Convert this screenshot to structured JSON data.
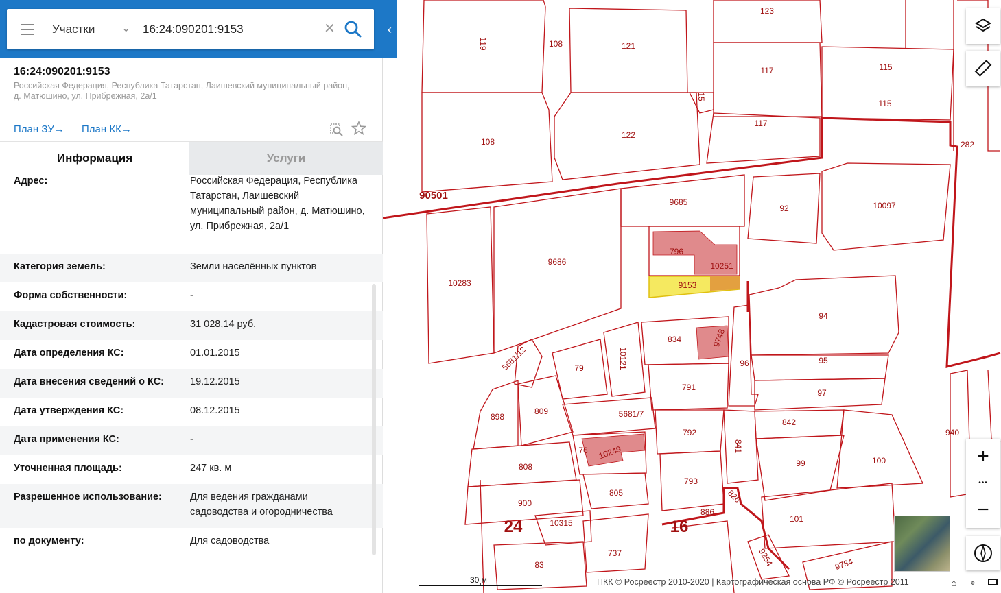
{
  "search": {
    "mode": "Участки",
    "query": "16:24:090201:9153"
  },
  "parcel": {
    "cadnum": "16:24:090201:9153",
    "address_short": "Российская Федерация, Республика Татарстан, Лаишевский муниципальный район, д. Матюшино, ул. Прибрежная, 2а/1",
    "plan_zu": "План ЗУ",
    "plan_kk": "План КК"
  },
  "tabs": {
    "info": "Информация",
    "services": "Услуги"
  },
  "rows": [
    {
      "label": "Адрес:",
      "value": "Российская Федерация, Республика Татарстан, Лаишевский муниципальный район, д. Матюшино, ул. Прибрежная, 2а/1"
    },
    {
      "label": "Категория земель:",
      "value": "Земли населённых пунктов"
    },
    {
      "label": "Форма собственности:",
      "value": "-"
    },
    {
      "label": "Кадастровая стоимость:",
      "value": "31 028,14 руб."
    },
    {
      "label": "Дата определения КС:",
      "value": "01.01.2015"
    },
    {
      "label": "Дата внесения сведений о КС:",
      "value": "19.12.2015"
    },
    {
      "label": "Дата утверждения КС:",
      "value": "08.12.2015"
    },
    {
      "label": "Дата применения КС:",
      "value": "-"
    },
    {
      "label": "Уточненная площадь:",
      "value": "247 кв. м"
    },
    {
      "label": "Разрешенное использование:",
      "value": "Для ведения гражданами садоводства и огородничества"
    },
    {
      "label": "по документу:",
      "value": "Для садоводства"
    }
  ],
  "map": {
    "labels": [
      "123",
      "119",
      "108",
      "121",
      "117",
      "115",
      "115",
      "15",
      "117",
      "122",
      "108",
      "282",
      "90501",
      "9685",
      "92",
      "10097",
      "10283",
      "9686",
      "796",
      "10251",
      "9153",
      "94",
      "834",
      "9748",
      "96",
      "5681/12",
      "79",
      "10121",
      "95",
      "791",
      "97",
      "898",
      "809",
      "5681/7",
      "842",
      "940",
      "792",
      "841",
      "99",
      "100",
      "76",
      "10249",
      "808",
      "793",
      "805",
      "826",
      "900",
      "886",
      "101",
      "24",
      "10315",
      "16",
      "737",
      "9254",
      "9784",
      "83"
    ],
    "scale": "30 м",
    "attribution": "ПКК © Росреестр 2010-2020 | Картографическая основа РФ © Росреестр 2011",
    "zoom_in": "+",
    "zoom_out": "−",
    "more": "•••"
  },
  "colors": {
    "header": "#1d78c7",
    "parcel_line": "#c0161b",
    "selected": "#f5e960",
    "building": "#e08a8c"
  }
}
